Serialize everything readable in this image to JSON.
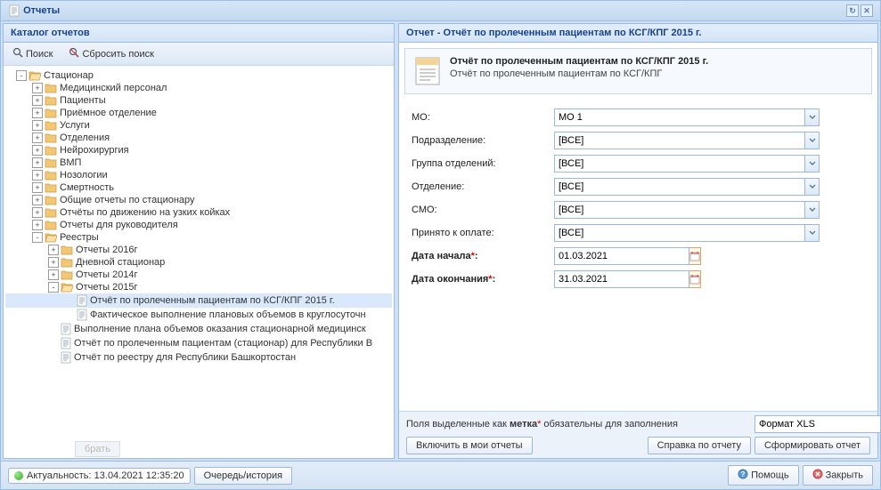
{
  "window": {
    "title": "Отчеты"
  },
  "catalog": {
    "title": "Каталог отчетов",
    "search_label": "Поиск",
    "reset_label": "Сбросить поиск",
    "ghost_button": "брать",
    "tree": [
      {
        "depth": 0,
        "exp": "-",
        "icon": "folder-open",
        "label": "Стационар"
      },
      {
        "depth": 1,
        "exp": "+",
        "icon": "folder",
        "label": "Медицинский персонал"
      },
      {
        "depth": 1,
        "exp": "+",
        "icon": "folder",
        "label": "Пациенты"
      },
      {
        "depth": 1,
        "exp": "+",
        "icon": "folder",
        "label": "Приёмное отделение"
      },
      {
        "depth": 1,
        "exp": "+",
        "icon": "folder",
        "label": "Услуги"
      },
      {
        "depth": 1,
        "exp": "+",
        "icon": "folder",
        "label": "Отделения"
      },
      {
        "depth": 1,
        "exp": "+",
        "icon": "folder",
        "label": "Нейрохирургия"
      },
      {
        "depth": 1,
        "exp": "+",
        "icon": "folder",
        "label": "ВМП"
      },
      {
        "depth": 1,
        "exp": "+",
        "icon": "folder",
        "label": "Нозологии"
      },
      {
        "depth": 1,
        "exp": "+",
        "icon": "folder",
        "label": "Смертность"
      },
      {
        "depth": 1,
        "exp": "+",
        "icon": "folder",
        "label": "Общие отчеты по стационару"
      },
      {
        "depth": 1,
        "exp": "+",
        "icon": "folder",
        "label": "Отчёты по движению на узких койках"
      },
      {
        "depth": 1,
        "exp": "+",
        "icon": "folder",
        "label": "Отчеты для руководителя"
      },
      {
        "depth": 1,
        "exp": "-",
        "icon": "folder-open",
        "label": "Реестры"
      },
      {
        "depth": 2,
        "exp": "+",
        "icon": "folder",
        "label": "Отчеты 2016г"
      },
      {
        "depth": 2,
        "exp": "+",
        "icon": "folder",
        "label": "Дневной стационар"
      },
      {
        "depth": 2,
        "exp": "+",
        "icon": "folder",
        "label": "Отчеты 2014г"
      },
      {
        "depth": 2,
        "exp": "-",
        "icon": "folder-open",
        "label": "Отчеты 2015г"
      },
      {
        "depth": 3,
        "exp": "",
        "icon": "doc",
        "label": "Отчёт по пролеченным пациентам по КСГ/КПГ 2015 г.",
        "selected": true
      },
      {
        "depth": 3,
        "exp": "",
        "icon": "doc",
        "label": "Фактическое выполнение плановых объемов в круглосуточн"
      },
      {
        "depth": 2,
        "exp": "",
        "icon": "doc",
        "label": "Выполнение плана объемов оказания стационарной медицинск"
      },
      {
        "depth": 2,
        "exp": "",
        "icon": "doc",
        "label": "Отчёт по пролеченным пациентам (стационар) для Республики В"
      },
      {
        "depth": 2,
        "exp": "",
        "icon": "doc",
        "label": "Отчёт по реестру для Республики Башкортостан"
      }
    ]
  },
  "report": {
    "panel_title": "Отчет - Отчёт по пролеченным пациентам по КСГ/КПГ 2015 г.",
    "head_title": "Отчёт по пролеченным пациентам по КСГ/КПГ 2015 г.",
    "head_desc": "Отчёт по пролеченным пациентам по КСГ/КПГ",
    "fields": {
      "mo": {
        "label": "МО:",
        "value": "МО 1"
      },
      "subdiv": {
        "label": "Подразделение:",
        "value": "[ВСЕ]"
      },
      "group": {
        "label": "Группа отделений:",
        "value": "[ВСЕ]"
      },
      "dept": {
        "label": "Отделение:",
        "value": "[ВСЕ]"
      },
      "smo": {
        "label": "СМО:",
        "value": "[ВСЕ]"
      },
      "paid": {
        "label": "Принято к оплате:",
        "value": "[ВСЕ]"
      },
      "date_from": {
        "label": "Дата начала",
        "value": "01.03.2021"
      },
      "date_to": {
        "label": "Дата окончания",
        "value": "31.03.2021"
      }
    },
    "hint_pre": "Поля выделенные как ",
    "hint_bold": "метка",
    "hint_post": " обязательны для заполнения",
    "format_value": "Формат XLS",
    "btn_add": "Включить в мои отчеты",
    "btn_help": "Справка по отчету",
    "btn_build": "Сформировать отчет"
  },
  "bottom": {
    "status_label": "Актуальность: 13.04.2021 12:35:20",
    "queue_label": "Очередь/история",
    "help": "Помощь",
    "close": "Закрыть"
  }
}
